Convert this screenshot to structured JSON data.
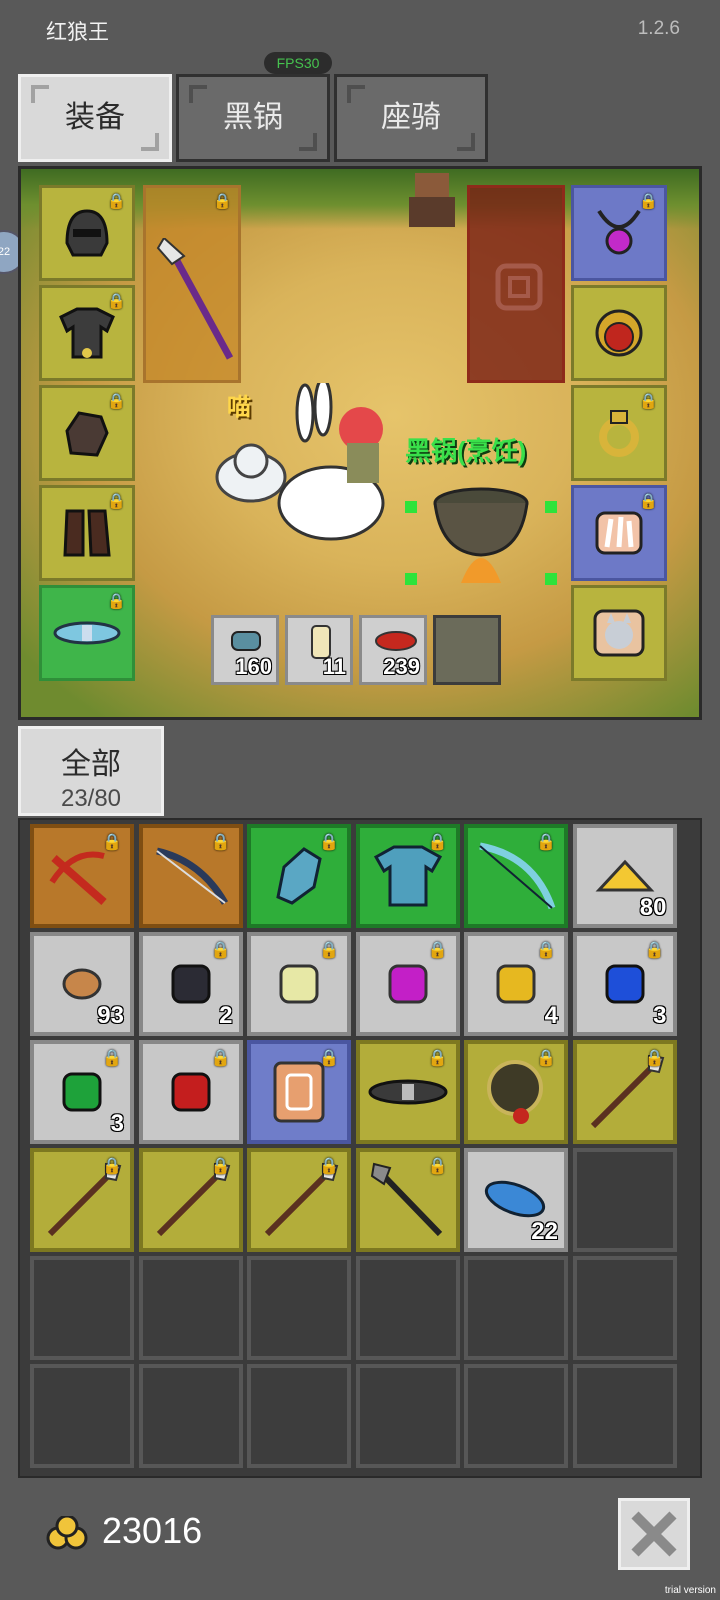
{
  "header": {
    "title": "红狼王",
    "version": "1.2.6",
    "fps": "FPS30"
  },
  "side_badge": "22",
  "tabs": [
    {
      "label": "装备",
      "active": true
    },
    {
      "label": "黑锅",
      "active": false
    },
    {
      "label": "座骑",
      "active": false
    }
  ],
  "scene": {
    "cat_label": "喵",
    "pot_label": "黑锅(烹饪)",
    "left_slots": [
      "helmet-icon",
      "armor-icon",
      "gloves-icon",
      "boots-icon",
      "belt-icon"
    ],
    "right_slots": [
      "necklace-icon",
      "ring-red-icon",
      "ring-gold-icon",
      "feather-charm-icon",
      "cat-pet-icon"
    ],
    "quick_items": [
      {
        "icon": "potion-blue-icon",
        "count": "160"
      },
      {
        "icon": "scroll-icon",
        "count": "11"
      },
      {
        "icon": "meat-icon",
        "count": "239"
      },
      {
        "icon": "empty-slot-icon",
        "count": ""
      }
    ]
  },
  "filter": {
    "label": "全部",
    "count": "23/80"
  },
  "inventory": [
    {
      "icon": "crossbow-icon",
      "rarity": "orange",
      "locked": true,
      "count": ""
    },
    {
      "icon": "bow-icon",
      "rarity": "orange",
      "locked": true,
      "count": ""
    },
    {
      "icon": "gauntlet-blue-icon",
      "rarity": "green",
      "locked": true,
      "count": ""
    },
    {
      "icon": "chestplate-blue-icon",
      "rarity": "green",
      "locked": true,
      "count": ""
    },
    {
      "icon": "bow-blue-icon",
      "rarity": "green",
      "locked": true,
      "count": ""
    },
    {
      "icon": "cheese-icon",
      "rarity": "grey",
      "locked": false,
      "count": "80"
    },
    {
      "icon": "ore-icon",
      "rarity": "grey",
      "locked": false,
      "count": "93"
    },
    {
      "icon": "gem-black-icon",
      "rarity": "grey",
      "locked": true,
      "count": "2"
    },
    {
      "icon": "gem-pale-icon",
      "rarity": "grey",
      "locked": true,
      "count": ""
    },
    {
      "icon": "gem-purple-icon",
      "rarity": "grey",
      "locked": true,
      "count": ""
    },
    {
      "icon": "gem-yellow-icon",
      "rarity": "grey",
      "locked": true,
      "count": "4"
    },
    {
      "icon": "gem-blue-icon",
      "rarity": "grey",
      "locked": true,
      "count": "3"
    },
    {
      "icon": "gem-green-icon",
      "rarity": "grey",
      "locked": true,
      "count": "3"
    },
    {
      "icon": "gem-red-icon",
      "rarity": "grey",
      "locked": true,
      "count": ""
    },
    {
      "icon": "scroll-card-icon",
      "rarity": "blue",
      "locked": true,
      "count": ""
    },
    {
      "icon": "belt-black-icon",
      "rarity": "olive",
      "locked": true,
      "count": ""
    },
    {
      "icon": "amulet-dark-icon",
      "rarity": "olive",
      "locked": true,
      "count": ""
    },
    {
      "icon": "spear-icon",
      "rarity": "olive",
      "locked": true,
      "count": ""
    },
    {
      "icon": "spear-icon",
      "rarity": "olive",
      "locked": true,
      "count": ""
    },
    {
      "icon": "spear-icon",
      "rarity": "olive",
      "locked": true,
      "count": ""
    },
    {
      "icon": "spear-icon",
      "rarity": "olive",
      "locked": true,
      "count": ""
    },
    {
      "icon": "spear-dark-icon",
      "rarity": "olive",
      "locked": true,
      "count": ""
    },
    {
      "icon": "feather-blue-icon",
      "rarity": "grey",
      "locked": false,
      "count": "22"
    },
    {
      "icon": "",
      "rarity": "empty",
      "locked": false,
      "count": ""
    },
    {
      "icon": "",
      "rarity": "empty",
      "locked": false,
      "count": ""
    },
    {
      "icon": "",
      "rarity": "empty",
      "locked": false,
      "count": ""
    },
    {
      "icon": "",
      "rarity": "empty",
      "locked": false,
      "count": ""
    },
    {
      "icon": "",
      "rarity": "empty",
      "locked": false,
      "count": ""
    },
    {
      "icon": "",
      "rarity": "empty",
      "locked": false,
      "count": ""
    },
    {
      "icon": "",
      "rarity": "empty",
      "locked": false,
      "count": ""
    },
    {
      "icon": "",
      "rarity": "empty",
      "locked": false,
      "count": ""
    },
    {
      "icon": "",
      "rarity": "empty",
      "locked": false,
      "count": ""
    },
    {
      "icon": "",
      "rarity": "empty",
      "locked": false,
      "count": ""
    },
    {
      "icon": "",
      "rarity": "empty",
      "locked": false,
      "count": ""
    },
    {
      "icon": "",
      "rarity": "empty",
      "locked": false,
      "count": ""
    },
    {
      "icon": "",
      "rarity": "empty",
      "locked": false,
      "count": ""
    }
  ],
  "footer": {
    "gold": "23016",
    "trial": "trial version"
  }
}
